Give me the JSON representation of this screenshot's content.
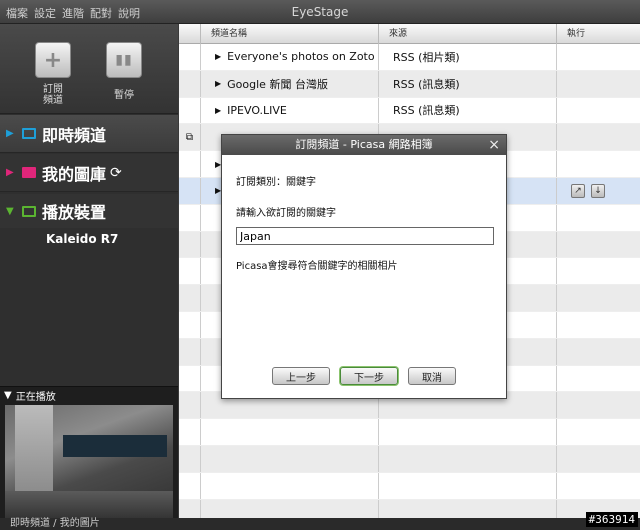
{
  "menu": [
    "檔案",
    "設定",
    "進階",
    "配對",
    "說明"
  ],
  "app_title": "EyeStage",
  "toolbar": {
    "add_label_line1": "訂閱",
    "add_label_line2": "頻道",
    "pause_label": "暫停"
  },
  "nav": {
    "live": "即時頻道",
    "gallery": "我的圖庫",
    "device": "播放裝置",
    "device_name": "Kaleido R7"
  },
  "nowplaying": {
    "label": "正在播放"
  },
  "status": {
    "path": "即時頻道 / 我的圖片",
    "watermark": "#363914"
  },
  "table": {
    "headers": {
      "name": "頻道名稱",
      "source": "來源",
      "action": "執行"
    },
    "rows": [
      {
        "name": "Everyone's photos on Zoto",
        "source": "RSS (相片類)"
      },
      {
        "name": "Google 新聞 台灣版",
        "source": "RSS (訊息類)"
      },
      {
        "name": "IPEVO.LIVE",
        "source": "RSS (訊息類)"
      }
    ]
  },
  "dialog": {
    "title": "訂閱頻道 - Picasa 網路相簿",
    "close": "×",
    "category_label": "訂閱類別：關鍵字",
    "prompt": "請輸入欲訂閱的關鍵字",
    "input_value": "Japan",
    "hint": "Picasa會搜尋符合關鍵字的相關相片",
    "prev": "上一步",
    "next": "下一步",
    "cancel": "取消"
  },
  "colors": {
    "live_icon": "#1e9fd8",
    "gallery_icon": "#e0267a",
    "device_icon": "#5bb531"
  }
}
